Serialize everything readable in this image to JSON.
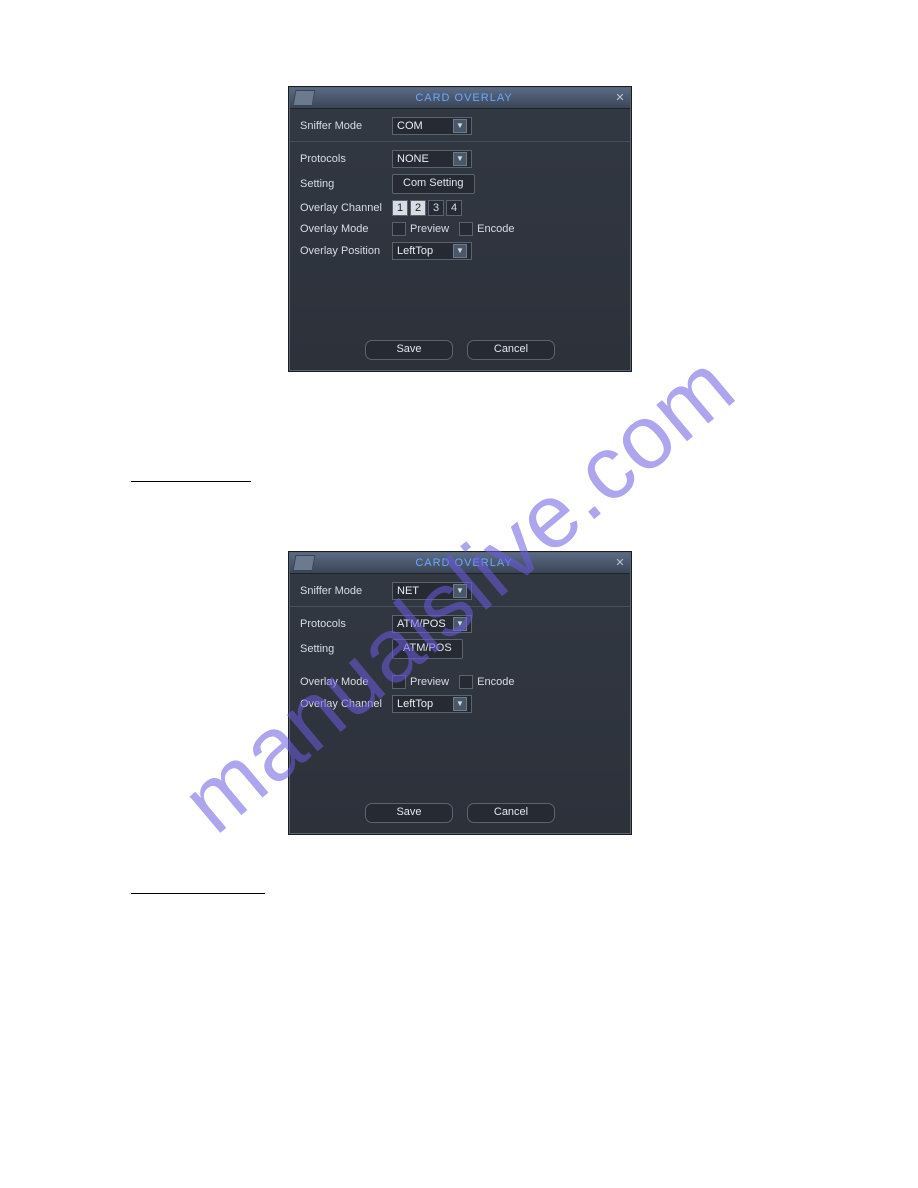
{
  "watermark": "manualslive.com",
  "dialog1": {
    "title": "CARD OVERLAY",
    "labels": {
      "sniffer_mode": "Sniffer Mode",
      "protocols": "Protocols",
      "setting": "Setting",
      "overlay_channel": "Overlay Channel",
      "overlay_mode": "Overlay Mode",
      "overlay_position": "Overlay Position"
    },
    "sniffer_mode": "COM",
    "protocols": "NONE",
    "com_setting_button": "Com Setting",
    "channels": [
      "1",
      "2",
      "3",
      "4"
    ],
    "overlay_mode_preview": "Preview",
    "overlay_mode_encode": "Encode",
    "overlay_position": "LeftTop",
    "save": "Save",
    "cancel": "Cancel"
  },
  "dialog2": {
    "title": "CARD OVERLAY",
    "labels": {
      "sniffer_mode": "Sniffer Mode",
      "protocols": "Protocols",
      "setting": "Setting",
      "overlay_mode": "Overlay Mode",
      "overlay_channel": "Overlay Channel"
    },
    "sniffer_mode": "NET",
    "protocols": "ATM/POS",
    "atm_pos_button": "ATM/POS",
    "overlay_mode_preview": "Preview",
    "overlay_mode_encode": "Encode",
    "overlay_channel": "LeftTop",
    "save": "Save",
    "cancel": "Cancel"
  },
  "captions": {
    "cap1": "",
    "cap2": ""
  }
}
